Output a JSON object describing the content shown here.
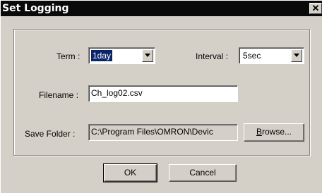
{
  "dialog": {
    "title": "Set Logging",
    "close_glyph": "✕"
  },
  "term": {
    "label": "Term :",
    "value": "1day"
  },
  "interval": {
    "label": "Interval :",
    "value": "5sec"
  },
  "filename": {
    "label": "Filename :",
    "value": "Ch_log02.csv"
  },
  "save_folder": {
    "label": "Save Folder :",
    "value": "C:\\Program Files\\OMRON\\Devic",
    "browse_accel": "B",
    "browse_rest": "rowse..."
  },
  "buttons": {
    "ok": "OK",
    "cancel": "Cancel"
  },
  "icons": {
    "dropdown": "triangle-down"
  }
}
